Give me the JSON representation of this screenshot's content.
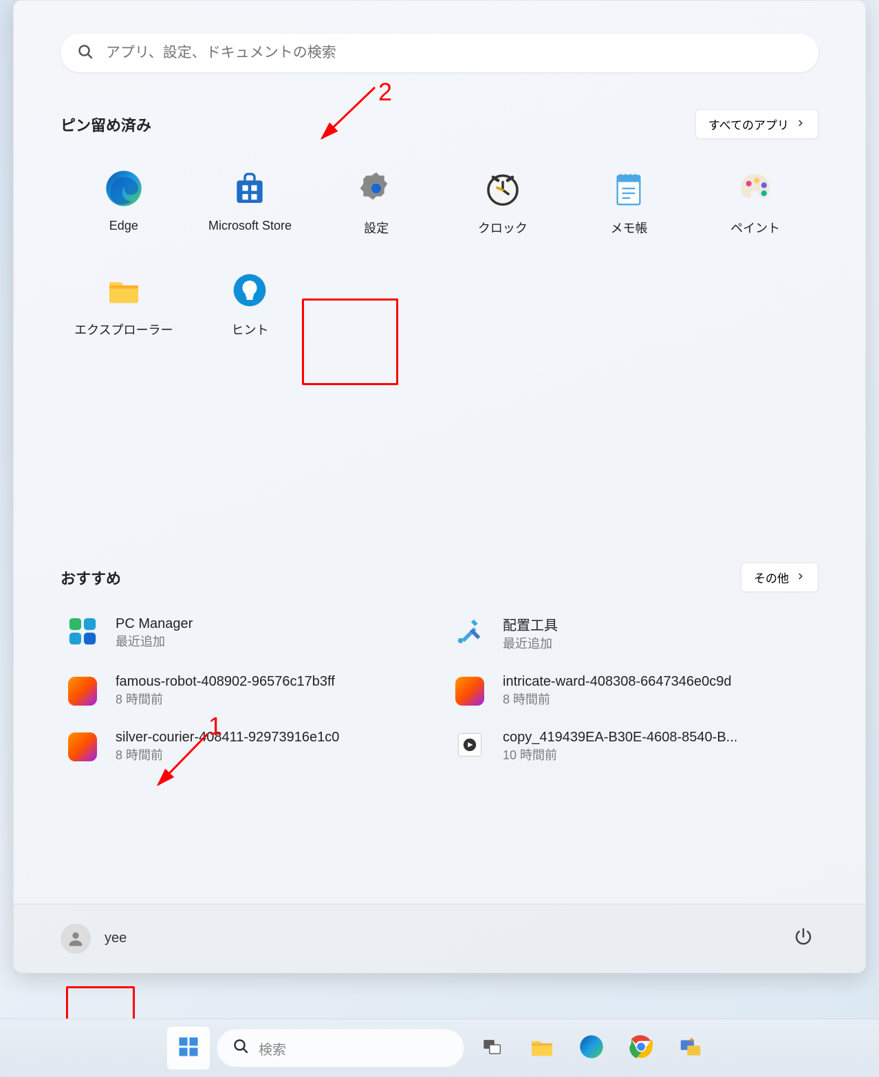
{
  "search": {
    "placeholder": "アプリ、設定、ドキュメントの検索"
  },
  "pinned": {
    "title": "ピン留め済み",
    "all_apps_label": "すべてのアプリ",
    "apps": [
      "Edge",
      "Microsoft Store",
      "設定",
      "クロック",
      "メモ帳",
      "ペイント",
      "エクスプローラー",
      "ヒント"
    ]
  },
  "recommended": {
    "title": "おすすめ",
    "more_label": "その他",
    "items": [
      {
        "title": "PC Manager",
        "sub": "最近追加"
      },
      {
        "title": "配置工具",
        "sub": "最近追加"
      },
      {
        "title": "famous-robot-408902-96576c17b3ff",
        "sub": "8 時間前"
      },
      {
        "title": "intricate-ward-408308-6647346e0c9d",
        "sub": "8 時間前"
      },
      {
        "title": "silver-courier-408411-92973916e1c0",
        "sub": "8 時間前"
      },
      {
        "title": "copy_419439EA-B30E-4608-8540-B...",
        "sub": "10 時間前"
      }
    ]
  },
  "user": {
    "name": "yee"
  },
  "taskbar": {
    "search_label": "検索"
  },
  "annotations": {
    "one": "1",
    "two": "2"
  }
}
